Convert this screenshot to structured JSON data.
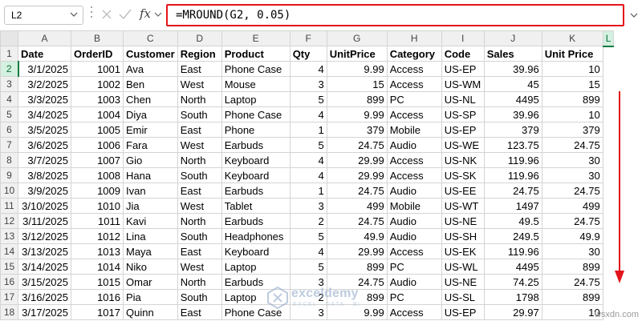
{
  "name_box": {
    "value": "L2"
  },
  "formula_bar": {
    "formula": "=MROUND(G2, 0.05)",
    "fx_label": "fx"
  },
  "columns": [
    "",
    "A",
    "B",
    "C",
    "D",
    "E",
    "F",
    "G",
    "H",
    "I",
    "J",
    "K",
    "L"
  ],
  "rows": [
    [
      "1",
      "Date",
      "OrderID",
      "Customer",
      "Region",
      "Product",
      "Qty",
      "UnitPrice",
      "Category",
      "Code",
      "Sales",
      "Unit Price"
    ],
    [
      "2",
      "3/1/2025",
      "1001",
      "Ava",
      "East",
      "Phone Case",
      "4",
      "9.99",
      "Access",
      "US-EP",
      "39.96",
      "10"
    ],
    [
      "3",
      "3/2/2025",
      "1002",
      "Ben",
      "West",
      "Mouse",
      "3",
      "15",
      "Access",
      "US-WM",
      "45",
      "15"
    ],
    [
      "4",
      "3/3/2025",
      "1003",
      "Chen",
      "North",
      "Laptop",
      "5",
      "899",
      "PC",
      "US-NL",
      "4495",
      "899"
    ],
    [
      "5",
      "3/4/2025",
      "1004",
      "Diya",
      "South",
      "Phone Case",
      "4",
      "9.99",
      "Access",
      "US-SP",
      "39.96",
      "10"
    ],
    [
      "6",
      "3/5/2025",
      "1005",
      "Emir",
      "East",
      "Phone",
      "1",
      "379",
      "Mobile",
      "US-EP",
      "379",
      "379"
    ],
    [
      "7",
      "3/6/2025",
      "1006",
      "Fara",
      "West",
      "Earbuds",
      "5",
      "24.75",
      "Audio",
      "US-WE",
      "123.75",
      "24.75"
    ],
    [
      "8",
      "3/7/2025",
      "1007",
      "Gio",
      "North",
      "Keyboard",
      "4",
      "29.99",
      "Access",
      "US-NK",
      "119.96",
      "30"
    ],
    [
      "9",
      "3/8/2025",
      "1008",
      "Hana",
      "South",
      "Keyboard",
      "4",
      "29.99",
      "Access",
      "US-SK",
      "119.96",
      "30"
    ],
    [
      "10",
      "3/9/2025",
      "1009",
      "Ivan",
      "East",
      "Earbuds",
      "1",
      "24.75",
      "Audio",
      "US-EE",
      "24.75",
      "24.75"
    ],
    [
      "11",
      "3/10/2025",
      "1010",
      "Jia",
      "West",
      "Tablet",
      "3",
      "499",
      "Mobile",
      "US-WT",
      "1497",
      "499"
    ],
    [
      "12",
      "3/11/2025",
      "1011",
      "Kavi",
      "North",
      "Earbuds",
      "2",
      "24.75",
      "Audio",
      "US-NE",
      "49.5",
      "24.75"
    ],
    [
      "13",
      "3/12/2025",
      "1012",
      "Lina",
      "South",
      "Headphones",
      "5",
      "49.9",
      "Audio",
      "US-SH",
      "249.5",
      "49.9"
    ],
    [
      "14",
      "3/13/2025",
      "1013",
      "Maya",
      "East",
      "Keyboard",
      "4",
      "29.99",
      "Access",
      "US-EK",
      "119.96",
      "30"
    ],
    [
      "15",
      "3/14/2025",
      "1014",
      "Niko",
      "West",
      "Laptop",
      "5",
      "899",
      "PC",
      "US-WL",
      "4495",
      "899"
    ],
    [
      "16",
      "3/15/2025",
      "1015",
      "Omar",
      "North",
      "Earbuds",
      "3",
      "24.75",
      "Audio",
      "US-NE",
      "74.25",
      "24.75"
    ],
    [
      "17",
      "3/16/2025",
      "1016",
      "Pia",
      "South",
      "Laptop",
      "2",
      "899",
      "PC",
      "US-SL",
      "1798",
      "899"
    ],
    [
      "18",
      "3/17/2025",
      "1017",
      "Quinn",
      "East",
      "Phone Case",
      "3",
      "9.99",
      "Access",
      "US-EP",
      "29.97",
      "10"
    ]
  ],
  "active_cell": {
    "column": "L",
    "row": "2"
  },
  "icons": {
    "cancel": "x-icon",
    "enter": "check-icon",
    "name_box_caret": "chevron-down-icon",
    "annotation": "red-down-arrow-icon"
  },
  "colors": {
    "formula_highlight": "#e3151a",
    "selection": "#107c41",
    "annotation_arrow": "#e3151a"
  },
  "watermark": {
    "name": "exceldemy",
    "tagline": "EXCEL · DATA · BI"
  },
  "corner_logo": "wsxdn.com"
}
